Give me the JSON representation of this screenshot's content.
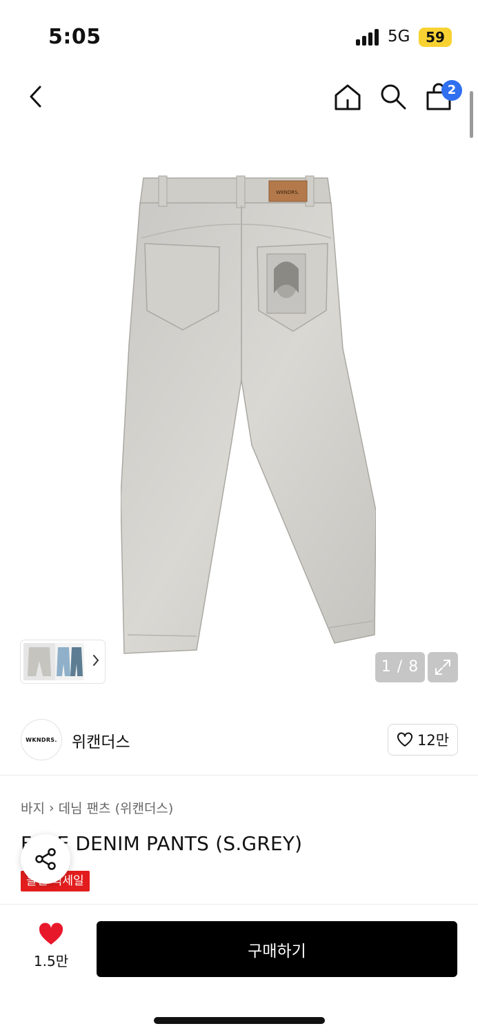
{
  "status_bar": {
    "time": "5:05",
    "network": "5G",
    "battery": "59"
  },
  "nav": {
    "cart_count": "2",
    "icons": [
      "back-arrow-icon",
      "home-icon",
      "search-icon",
      "shopping-bag-icon"
    ]
  },
  "gallery": {
    "brand_tag": "WKNDRS.",
    "page_indicator": "1 / 8",
    "current_page": 1,
    "total_pages": 8
  },
  "brand": {
    "logo_text": "WKNDRS.",
    "name": "위캔더스",
    "likes": "12만"
  },
  "breadcrumb": {
    "items": [
      "바지",
      "데님 팬츠 (위캔더스)"
    ],
    "separator": "›"
  },
  "product": {
    "title": "FACE DENIM PANTS (S.GREY)",
    "sale_badge": "올인 럭세일"
  },
  "bottom_bar": {
    "wish_count": "1.5만",
    "buy_label": "구매하기"
  },
  "colors": {
    "accent_blue": "#2f6ff0",
    "sale_red": "#e31d1d",
    "heart_red": "#e8182b",
    "battery_yellow": "#f7d232",
    "buy_button": "#000000"
  }
}
